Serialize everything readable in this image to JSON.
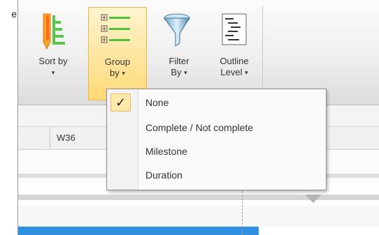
{
  "left_text": "e",
  "ribbon": {
    "buttons": [
      {
        "line1": "Sort by",
        "line2": "",
        "has_arrow": true
      },
      {
        "line1": "Group",
        "line2": "by",
        "has_arrow": true
      },
      {
        "line1": "Filter",
        "line2": "By",
        "has_arrow": true
      },
      {
        "line1": "Outline",
        "line2": "Level",
        "has_arrow": true
      }
    ],
    "arrow_glyph": "▾",
    "active_button": "Group by"
  },
  "timeline": {
    "week_label": "W36"
  },
  "group_menu": {
    "items": [
      {
        "label": "None",
        "checked": true
      },
      {
        "label": "Complete / Not complete",
        "checked": false
      },
      {
        "label": "Milestone",
        "checked": false
      },
      {
        "label": "Duration",
        "checked": false
      }
    ],
    "check_glyph": "✓"
  },
  "colors": {
    "active_highlight": "#ffd977",
    "task_bar": "#2f8fe0"
  }
}
